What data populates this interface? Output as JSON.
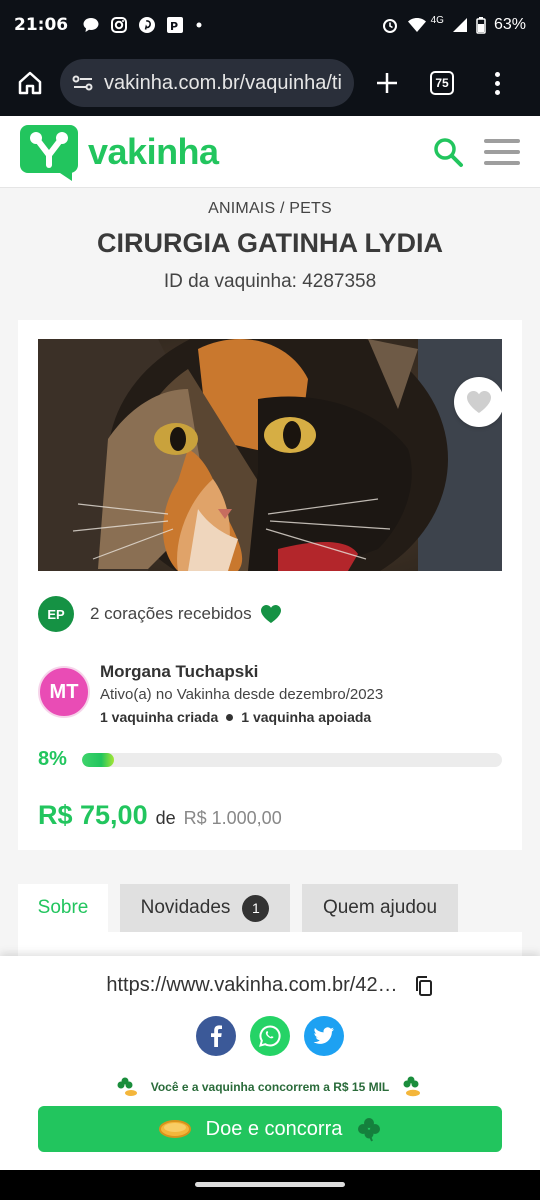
{
  "status_bar": {
    "time": "21:06",
    "network": "4G",
    "battery": "63%",
    "notification_icons": [
      "chat-bubble-icon",
      "instagram-icon",
      "pinterest-icon",
      "picpay-icon",
      "dot-icon"
    ]
  },
  "browser": {
    "url": "vakinha.com.br/vaquinha/ti",
    "tab_count": "75"
  },
  "site": {
    "logo_text": "vakinha",
    "brand_color": "#22c55e"
  },
  "campaign": {
    "category": "ANIMAIS / PETS",
    "title": "CIRURGIA GATINHA LYDIA",
    "id_label": "ID da vaquinha: 4287358",
    "hearts": {
      "avatar_initials": "EP",
      "text": "2 corações recebidos"
    },
    "owner": {
      "initials": "MT",
      "name": "Morgana Tuchapski",
      "since": "Ativo(a) no Vakinha desde dezembro/2023",
      "created": "1 vaquinha criada",
      "supported": "1 vaquinha apoiada"
    },
    "progress": {
      "percent_label": "8%",
      "fraction": 0.075
    },
    "amount": {
      "raised": "R$ 75,00",
      "of": "de",
      "goal": "R$ 1.000,00"
    }
  },
  "tabs": [
    {
      "label": "Sobre",
      "active": true
    },
    {
      "label": "Novidades",
      "badge": "1"
    },
    {
      "label": "Quem ajudou"
    }
  ],
  "share": {
    "url": "https://www.vakinha.com.br/42…",
    "promo": "Você e a vaquinha concorrem a R$ 15 MIL",
    "donate_label": "Doe e concorra"
  }
}
